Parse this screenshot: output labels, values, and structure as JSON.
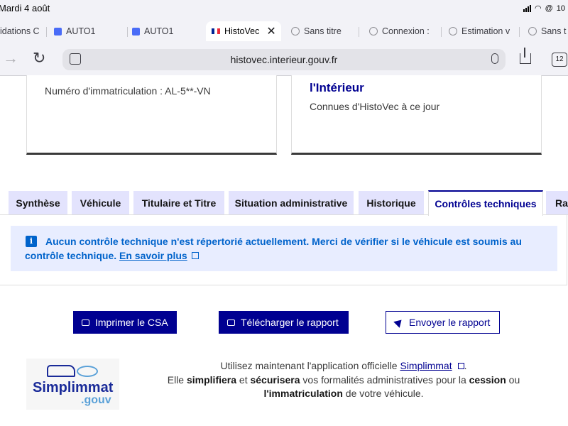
{
  "status_bar": {
    "time": "Mardi 4 août",
    "battery": "10"
  },
  "tabs": [
    {
      "title": "idations C"
    },
    {
      "title": "AUTO1"
    },
    {
      "title": "AUTO1"
    },
    {
      "title": "HistoVec"
    },
    {
      "title": "Sans titre"
    },
    {
      "title": "Connexion :"
    },
    {
      "title": "Estimation v"
    },
    {
      "title": "Sans t"
    }
  ],
  "address_bar": {
    "url": "histovec.interieur.gouv.fr",
    "tab_count": "12"
  },
  "cards": {
    "left": {
      "text": "Numéro d'immatriculation : AL-5**-VN"
    },
    "right": {
      "title": "l'Intérieur",
      "text": "Connues d'HistoVec à ce jour"
    }
  },
  "page_tabs": [
    "Synthèse",
    "Véhicule",
    "Titulaire et Titre",
    "Situation administrative",
    "Historique",
    "Contrôles techniques",
    "Rap"
  ],
  "alert": {
    "text": "Aucun contrôle technique n'est répertorié actuellement. Merci de vérifier si le véhicule est soumis au contrôle technique.",
    "link": "En savoir plus"
  },
  "buttons": {
    "print": "Imprimer le CSA",
    "download": "Télécharger le rapport",
    "send": "Envoyer le rapport"
  },
  "logo": {
    "word": "Simplimmat",
    "suffix": ".gouv"
  },
  "footer": {
    "line1_prefix": "Utilisez maintenant l'application officielle ",
    "link": "Simplimmat",
    "line1_suffix": ".",
    "line2_a": "Elle ",
    "line2_b": "simplifiera",
    "line2_c": " et ",
    "line2_d": "sécurisera",
    "line2_e": " vos formalités administratives pour la ",
    "line2_f": "cession",
    "line2_g": " ou",
    "line3_a": "l'immatriculation",
    "line3_b": " de votre véhicule."
  },
  "colors": {
    "brand_blue": "#000091",
    "info_blue": "#0063cb",
    "alert_bg": "#e8edff",
    "tab_bg": "#e3e3fd"
  }
}
